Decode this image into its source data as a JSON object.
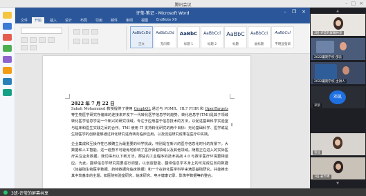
{
  "meeting": {
    "title": "腾讯会议"
  },
  "share_status": {
    "label": "3班-许莹的屏幕共享"
  },
  "word": {
    "doc_title": "许莹-笔记 - Microsoft Word",
    "tabs": [
      "文件",
      "开始",
      "插入",
      "设计",
      "布局",
      "引用",
      "邮件",
      "审阅",
      "视图",
      "EndNote X9"
    ],
    "styles": [
      {
        "sample": "AaBbCcDd",
        "name": "正文"
      },
      {
        "sample": "AaBbCcDd",
        "name": "无间隔"
      },
      {
        "sample": "AaBbC",
        "name": "标题 1"
      },
      {
        "sample": "AaBbCcl",
        "name": "标题 2"
      },
      {
        "sample": "AaBbC",
        "name": "标题"
      },
      {
        "sample": "AaBbCcI",
        "name": "副标题"
      },
      {
        "sample": "AaBbCcl",
        "name": "不明显强调"
      }
    ],
    "doc": {
      "date": "2022 年 7 月 22 日",
      "para1_a": "Sabah Mohammed 教授提供了使用 ",
      "para1_graphql": "GraphQL",
      "para1_b": " 通过与 POMR、HL7 FHIR 和 ",
      "para1_opentargets": "OpenTargets",
      "para1_c": " 等生物医学研究存储库的连接来开发下一代转化医学信息学的趋势。转化信息学(TMI)是其子领域转化医学信息学是一个新兴的研究领域，专注于应用基于信息技术的方法，以促进基础科学实验室与临床和医生实践之间的合作。TMI 使用 IT 支持转化研究的两个目标：无论基础科学、医学或是生物医学的创新能够通过转化研究进而转向临床应用，以及促进研究成果在医疗中实践。",
      "para2": "企业集成和互操作性已被确立为最重要的科学挑战，特别是在新兴的医疗信息化时代的背景下。大数据和人工智能，这一趋势不可避免地影响了医疗保健领域以及其他领域。随着正在进入的实际医疗关注业务数据，我们得出以下新方法。那些内工业程序的技术挑战 4.0 与数字医疗环境更相适应。为此，翻译信息学研究需要进行调整，以创造智能、翻译信息学本身上的可完成任务的数据（如基础生物医学数据、药物数据和临床数据）和一个在转化医学科学来满足基础研究，并能推出其中较基本的主题，如医院实验室研究、临床研究、电子健康记录、影像学数据等的整合。"
    }
  },
  "participants": [
    {
      "name": "3班-许莹的屏幕共享"
    },
    {
      "name": "2022暑期学校-邵云"
    },
    {
      "name": "2022暑期学校-主讲人"
    },
    {
      "name": "邓凯",
      "initials": "邓凯"
    },
    {
      "name": "张仙"
    },
    {
      "name": "3班-姜华峰"
    }
  ],
  "colors": {
    "word_blue": "#2b579a",
    "sidebar_bg": "#1d1f24",
    "status_green": "#28c46a"
  }
}
